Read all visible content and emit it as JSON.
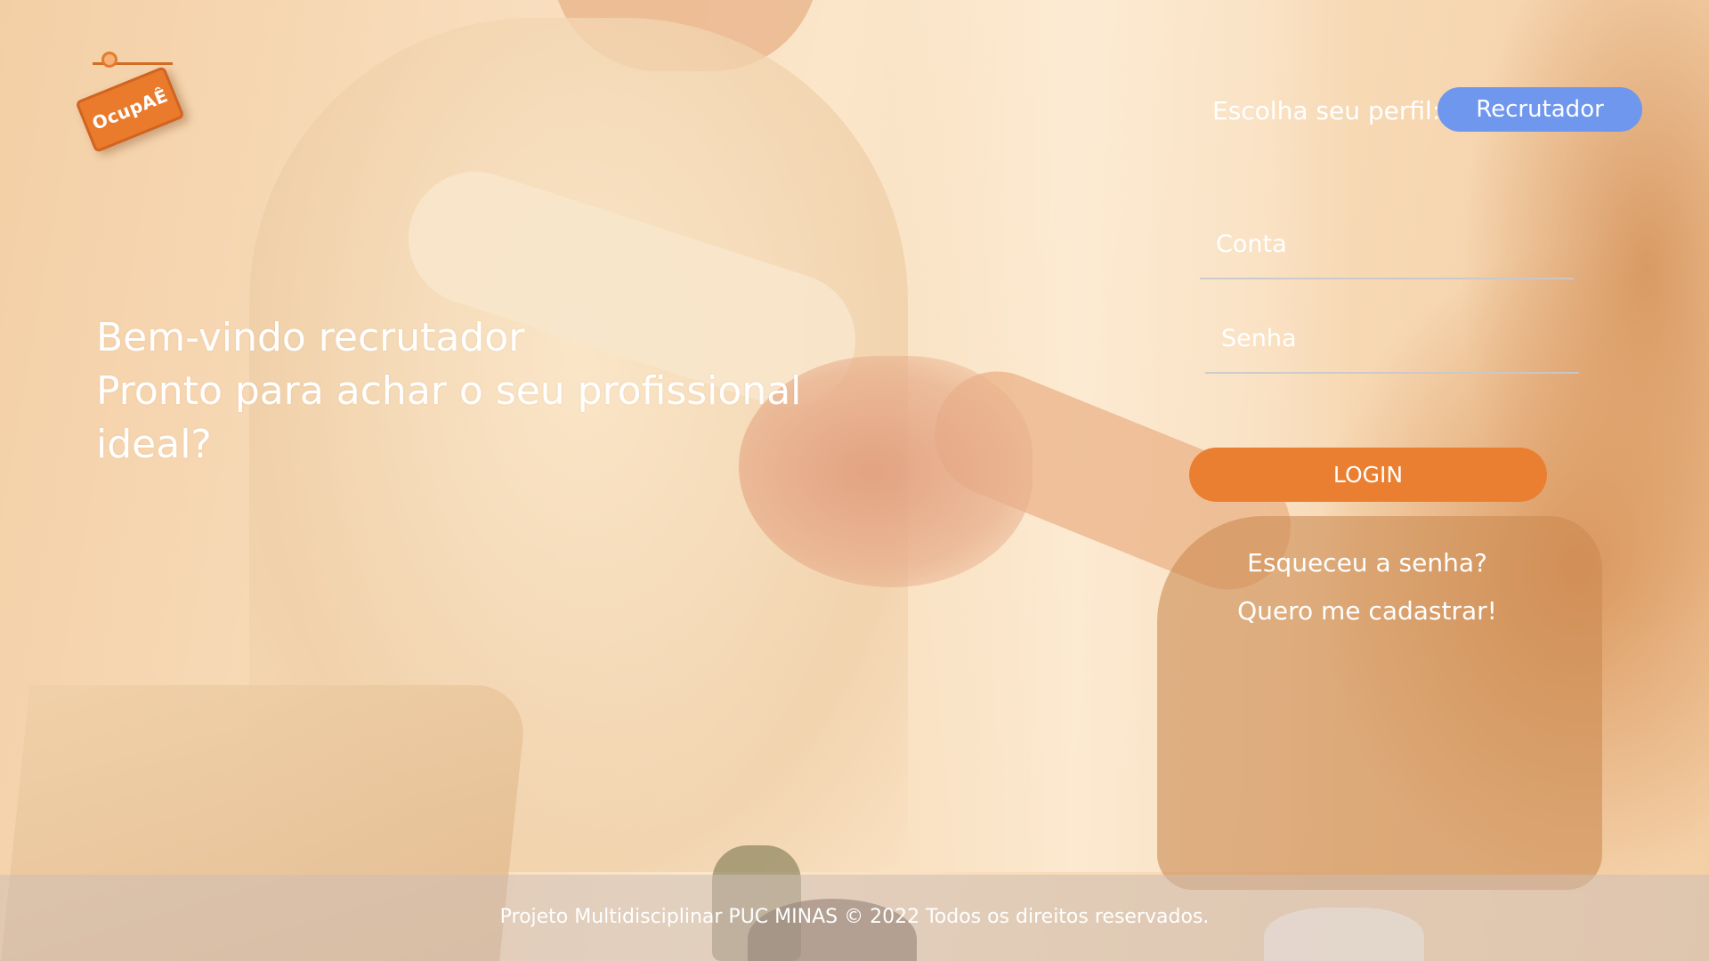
{
  "logo": {
    "text": "OcupAÊ"
  },
  "headline": {
    "line1": "Bem-vindo recrutador",
    "line2": "Pronto para achar o seu profissional",
    "line3": "ideal?"
  },
  "profile": {
    "label": "Escolha seu perfil:",
    "selected": "Recrutador"
  },
  "form": {
    "account_placeholder": "Conta",
    "password_placeholder": "Senha",
    "login_label": "LOGIN",
    "forgot_label": "Esqueceu a senha?",
    "register_label": "Quero me cadastrar!"
  },
  "footer": {
    "text": "Projeto Multidisciplinar  PUC MINAS © 2022 Todos os direitos reservados."
  },
  "colors": {
    "accent_orange": "#ea7f32",
    "profile_blue": "#6f97ee",
    "text_white": "#ffffff"
  }
}
